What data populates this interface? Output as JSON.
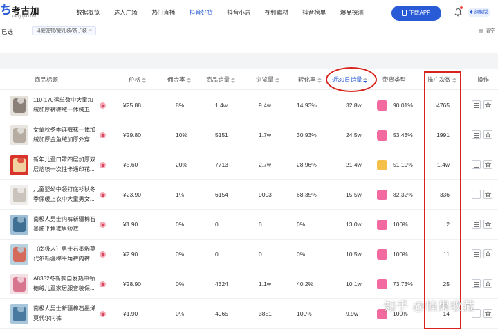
{
  "app": {
    "logo_text": "考古加",
    "logo_sub": "kaogujia.com"
  },
  "nav": [
    {
      "label": "数据概览",
      "active": false
    },
    {
      "label": "达人广场",
      "active": false
    },
    {
      "label": "热门直播",
      "active": false
    },
    {
      "label": "抖音好货",
      "active": true
    },
    {
      "label": "抖音小店",
      "active": false
    },
    {
      "label": "视频素材",
      "active": false
    },
    {
      "label": "抖音榜单",
      "active": false
    },
    {
      "label": "爆品探测",
      "active": false
    }
  ],
  "header": {
    "download_label": "下载APP",
    "vip_label": "旗舰版"
  },
  "filter": {
    "chosen_label": "已选",
    "chip_label": "母婴宠物/婴儿装/亲子装",
    "chip_close": "×",
    "clear_label": "清空"
  },
  "table": {
    "headers": {
      "product": "商品标题",
      "price": "价格",
      "commission": "佣金率",
      "sales": "商品销量",
      "views": "浏览量",
      "conversion": "转化率",
      "sales30": "近30日销量",
      "goods_type": "带货类型",
      "promo_count": "推广次数",
      "ops": "操作"
    },
    "rows": [
      {
        "title": "110-170运单数中大童加绒加厚裤裤绒一体绒卫...",
        "price": "¥25.88",
        "commission": "8%",
        "sales": "1.4w",
        "views": "9.4w",
        "conversion": "14.93%",
        "sales30": "32.8w",
        "type_pct": "90.01%",
        "type_color": "#f36aa0",
        "promo": "4765",
        "thumb_a": "#e5e2dc",
        "thumb_b": "#8b8178"
      },
      {
        "title": "女童秋冬季连裤袜一体加绒加厚金鱼绒加厚外穿...",
        "price": "¥29.80",
        "commission": "10%",
        "sales": "5151",
        "views": "1.7w",
        "conversion": "30.93%",
        "sales30": "24.5w",
        "type_pct": "53.43%",
        "type_color": "#f36aa0",
        "promo": "1991",
        "thumb_a": "#e9e6e2",
        "thumb_b": "#b6aca2"
      },
      {
        "title": "新年儿童口罩四层加厚双层熔喷一次性卡通印花...",
        "price": "¥5.60",
        "commission": "20%",
        "sales": "7713",
        "views": "2.7w",
        "conversion": "28.96%",
        "sales30": "21.4w",
        "type_pct": "51.19%",
        "type_color": "#f5c04a",
        "promo": "1.4w",
        "thumb_a": "#d9342b",
        "thumb_b": "#f2d1a0"
      },
      {
        "title": "儿童婴幼中领打底衫秋冬季保暖上衣中大童男女...",
        "price": "¥23.90",
        "commission": "1%",
        "sales": "6154",
        "views": "9003",
        "conversion": "68.35%",
        "sales30": "15.5w",
        "type_pct": "82.32%",
        "type_color": "#f36aa0",
        "promo": "336",
        "thumb_a": "#f0eeec",
        "thumb_b": "#c9c3bc"
      },
      {
        "title": "南极人男士内裤新疆棉石墨烯平角裤男短裤",
        "price": "¥1.90",
        "commission": "0%",
        "sales": "0",
        "views": "0",
        "conversion": "0%",
        "sales30": "13.0w",
        "type_pct": "100%",
        "type_color": "#f36aa0",
        "promo": "2",
        "thumb_a": "#9fc0d6",
        "thumb_b": "#3f6f93"
      },
      {
        "title": "（南极人）男士石墨烯莫代尔新疆棉平角裤内裤...",
        "price": "¥2.90",
        "commission": "0%",
        "sales": "0",
        "views": "0",
        "conversion": "0%",
        "sales30": "10.5w",
        "type_pct": "100%",
        "type_color": "#f36aa0",
        "promo": "11",
        "thumb_a": "#b8d3df",
        "thumb_b": "#d66a5a"
      },
      {
        "title": "A8332冬新款自发热中领德绒儿童家居服套装保...",
        "price": "¥28.90",
        "commission": "0%",
        "sales": "4324",
        "views": "1.1w",
        "conversion": "40.2%",
        "sales30": "10.1w",
        "type_pct": "73.73%",
        "type_color": "#f36aa0",
        "promo": "25",
        "thumb_a": "#f3dfe4",
        "thumb_b": "#d9768f"
      },
      {
        "title": "南极人男士新疆棉石墨烯莫代尔内裤",
        "price": "¥1.90",
        "commission": "0%",
        "sales": "4965",
        "views": "3851",
        "conversion": "100%",
        "sales30": "9.9w",
        "type_pct": "100%",
        "type_color": "#f36aa0",
        "promo": "14",
        "thumb_a": "#a9c7db",
        "thumb_b": "#4a7aa0"
      }
    ]
  },
  "watermark": "知乎 @楠果收藏"
}
